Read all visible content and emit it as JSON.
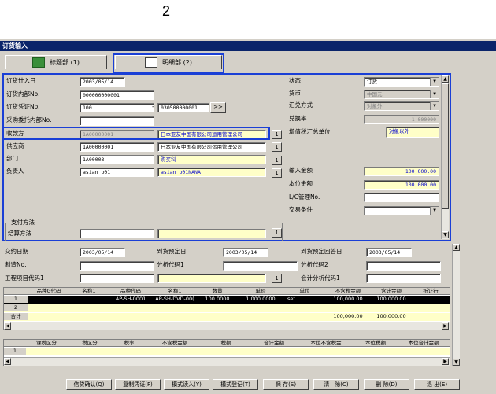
{
  "callouts": {
    "top": "2",
    "right": "1"
  },
  "window": {
    "title": "订货输入"
  },
  "tabs": [
    {
      "label": "标题部 (1)"
    },
    {
      "label": "明细部 (2)"
    }
  ],
  "left": {
    "order_date": {
      "label": "订货计入日",
      "value": "2003/05/14"
    },
    "internal_no": {
      "label": "订货内部No.",
      "value": "000000000001"
    },
    "voucher_no": {
      "label": "订货凭证No.",
      "value": "100",
      "sep": "-",
      "value2": "030500000001",
      "btn": ">>"
    },
    "purchase_req": {
      "label": "采购委托内部No.",
      "value": ""
    },
    "receiver": {
      "label": "收款方",
      "code": "1A00000001",
      "name": "日本亚友中国有限公司运用管理公司"
    },
    "supplier": {
      "label": "供应商",
      "code": "1A00000001",
      "name": "日本亚友中国有限公司运用管理公司"
    },
    "department": {
      "label": "部门",
      "code": "1A00003",
      "name": "购买科"
    },
    "person": {
      "label": "负责人",
      "code": "asian_p01",
      "name": "asian_p01NANA"
    },
    "payment_group": "支付方法",
    "settlement": {
      "label": "结算方法",
      "value": ""
    },
    "lookup_btn": "1"
  },
  "right": {
    "status": {
      "label": "状态",
      "value": "订货"
    },
    "currency": {
      "label": "货币",
      "value": "中国元"
    },
    "exchange_type": {
      "label": "汇兑方式",
      "value": "对象外"
    },
    "rate": {
      "label": "兑换率",
      "value": "1.000000"
    },
    "vat_unit": {
      "label": "增值税汇总单位",
      "value": "对象以外"
    },
    "input_amount": {
      "label": "输入金额",
      "value": "100,000.00"
    },
    "local_amount": {
      "label": "本位金额",
      "value": "100,000.00"
    },
    "lc_no": {
      "label": "L/C管理No.",
      "value": ""
    },
    "trade_terms": {
      "label": "交易条件",
      "value": ""
    }
  },
  "lower": {
    "delivery_date": {
      "label": "交约日期",
      "value": "2003/05/14"
    },
    "expected_arrival": {
      "label": "到货预定日",
      "value": "2003/05/14"
    },
    "expected_reply": {
      "label": "到货预定回答日",
      "value": "2003/05/14"
    },
    "manufacture_no": {
      "label": "制造No.",
      "value": ""
    },
    "analysis_code": {
      "label": "分析代码1",
      "value": ""
    },
    "analysis_code2": {
      "label": "分析代码2",
      "value": ""
    },
    "project_code": {
      "label": "工程项目代码1",
      "value": ""
    },
    "accounting_code": {
      "label": "会计分析代码1",
      "value": ""
    }
  },
  "grid1": {
    "headers": [
      "品种G代码",
      "名称1",
      "品种代码",
      "名称1",
      "数量",
      "单价",
      "单位",
      "不含税金额",
      "含计金额",
      "折让行"
    ],
    "rows": [
      {
        "no": "1",
        "cells": [
          "",
          "",
          "AP-SH-0001",
          "AP-SH-DVD-00(",
          "100.0000",
          "1,000.0000",
          "set",
          "100,000.00",
          "100,000.00",
          ""
        ]
      },
      {
        "no": "2",
        "cells": [
          "",
          "",
          "",
          "",
          "",
          "",
          "",
          "",
          "",
          ""
        ]
      }
    ],
    "total": {
      "label": "合计",
      "amount1": "100,000.00",
      "amount2": "100,000.00"
    }
  },
  "grid2": {
    "headers": [
      "课税区分",
      "税区分",
      "税率",
      "不含税金额",
      "税额",
      "合计金额",
      "本位不含税金",
      "本位税额",
      "本位合计金额"
    ],
    "rows": [
      {
        "no": "1"
      }
    ]
  },
  "footer": [
    "信贷确认(Q)",
    "复制凭证(F)",
    "模式读入(Y)",
    "模式登记(T)",
    "保 存(S)",
    "清　除(C)",
    "删 除(D)",
    "退 出(E)"
  ]
}
